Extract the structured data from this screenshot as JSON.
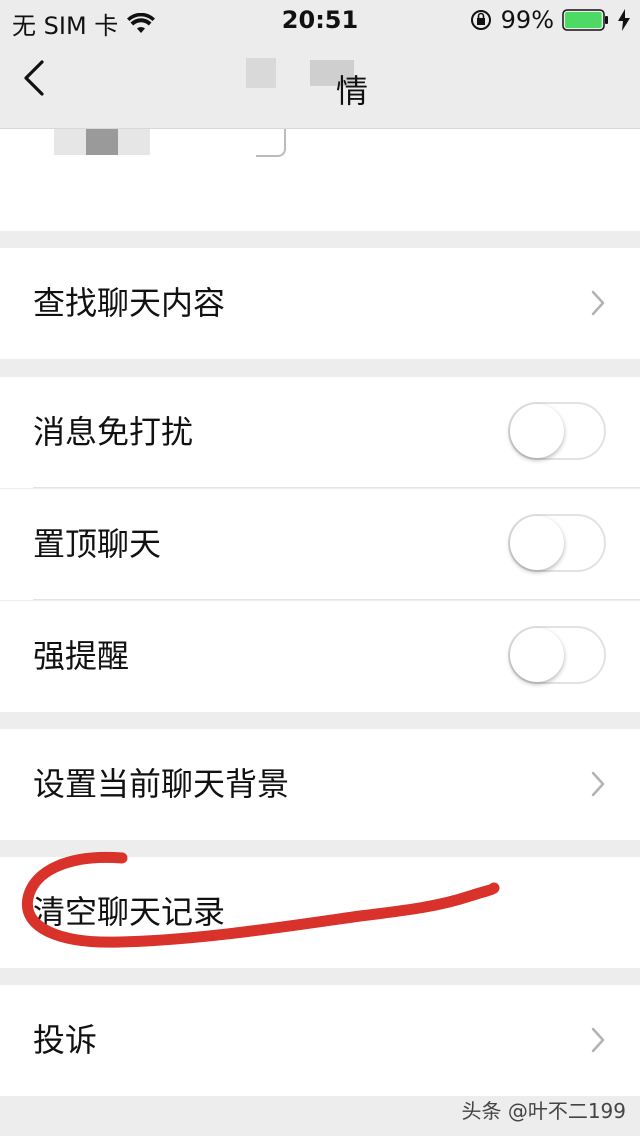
{
  "status_bar": {
    "carrier": "无 SIM 卡",
    "time": "20:51",
    "battery_percent": "99%",
    "battery_level": 0.99,
    "battery_color": "#4cd964"
  },
  "nav": {
    "title": "情",
    "back_icon": "chevron-left-icon"
  },
  "rows": {
    "search_chat": "查找聊天内容",
    "mute": "消息免打扰",
    "pin": "置顶聊天",
    "alert": "强提醒",
    "background": "设置当前聊天背景",
    "clear_history": "清空聊天记录",
    "report": "投诉"
  },
  "toggles": {
    "mute": false,
    "pin": false,
    "alert": false
  },
  "annotation": {
    "color": "#d8322a"
  },
  "watermark": "头条 @叶不二199"
}
